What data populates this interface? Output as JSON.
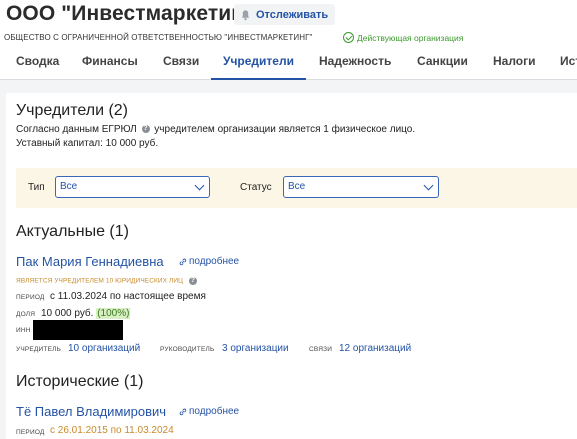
{
  "company": {
    "title": "ООО \"Инвестмаркетинг\"",
    "full_name": "ОБЩЕСТВО С ОГРАНИЧЕННОЙ ОТВЕТСТВЕННОСТЬЮ \"ИНВЕСТМАРКЕТИНГ\"",
    "status": "Действующая организация",
    "follow_label": "Отслеживать"
  },
  "tabs": [
    {
      "label": "Сводка"
    },
    {
      "label": "Финансы"
    },
    {
      "label": "Связи"
    },
    {
      "label": "Учредители",
      "active": true
    },
    {
      "label": "Надежность"
    },
    {
      "label": "Санкции"
    },
    {
      "label": "Налоги"
    },
    {
      "label": "Ист"
    }
  ],
  "founders": {
    "title": "Учредители (2)",
    "egrul_prefix": "Согласно данным ЕГРЮЛ",
    "egrul_suffix": "учредителем организации является 1 физическое лицо.",
    "capital": "Уставный капитал: 10 000 руб."
  },
  "filters": {
    "type_label": "Тип",
    "type_value": "Все",
    "status_label": "Статус",
    "status_value": "Все"
  },
  "current": {
    "title": "Актуальные (1)",
    "name": "Пак Мария Геннадиевна",
    "more": "подробнее",
    "note": "ЯВЛЯЕТСЯ УЧРЕДИТЕЛЕМ 10 ЮРИДИЧЕСКИХ ЛИЦ",
    "period_label": "период",
    "period_value": "с 11.03.2024 по настоящее время",
    "share_label": "доля",
    "share_value": "10 000 руб.",
    "share_percent": "(100%)",
    "inn_label": "ИНН",
    "founder_label": "учредитель",
    "founder_value": "10 организаций",
    "manager_label": "руководитель",
    "manager_value": "3 организации",
    "links_label": "связи",
    "links_value": "12 организаций"
  },
  "historical": {
    "title": "Исторические (1)",
    "name": "Тё Павел Владимирович",
    "more": "подробнее",
    "period_label": "период",
    "period_value": "с 26.01.2015 по 11.03.2024"
  },
  "colors": {
    "accent": "#2453a5",
    "active_status": "#3b9a2c",
    "note": "#c98a2a",
    "filter_bg": "#fbf6e5"
  }
}
